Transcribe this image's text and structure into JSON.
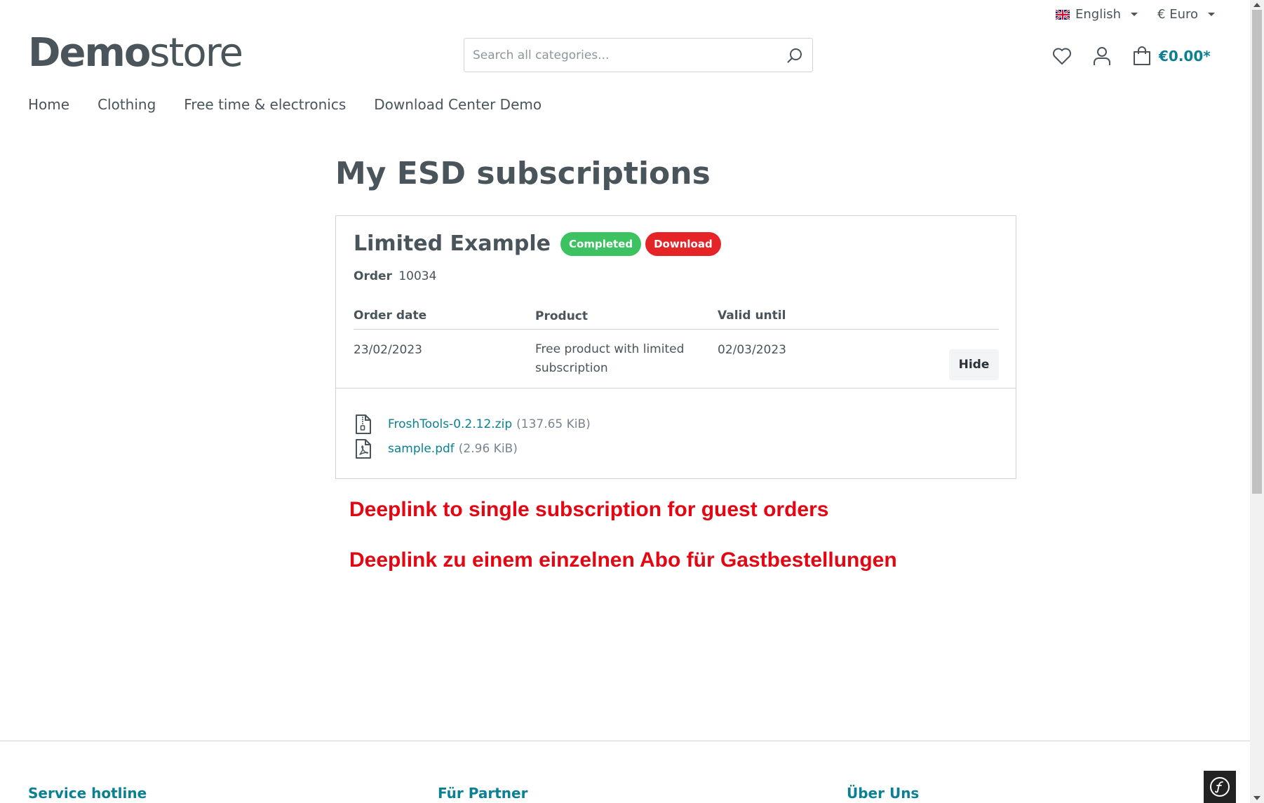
{
  "topbar": {
    "language": "English",
    "currency": "€ Euro"
  },
  "header": {
    "logo_bold": "Demo",
    "logo_light": "store",
    "search_placeholder": "Search all categories...",
    "cart_total": "€0.00*"
  },
  "nav": {
    "items": [
      {
        "label": "Home"
      },
      {
        "label": "Clothing"
      },
      {
        "label": "Free time & electronics"
      },
      {
        "label": "Download Center Demo"
      }
    ]
  },
  "main": {
    "title": "My ESD subscriptions",
    "subscription": {
      "title": "Limited Example",
      "status_badge": "Completed",
      "download_badge": "Download",
      "order_label": "Order",
      "order_number": "10034",
      "columns": [
        "Order date",
        "Product",
        "Valid until"
      ],
      "row": {
        "order_date": "23/02/2023",
        "product": "Free product with limited subscription",
        "valid_until": "02/03/2023",
        "action": "Hide"
      },
      "files": [
        {
          "name": "FroshTools-0.2.12.zip",
          "size": "(137.65 KiB)",
          "icon": "zip-file-icon"
        },
        {
          "name": "sample.pdf",
          "size": "(2.96 KiB)",
          "icon": "pdf-file-icon"
        }
      ]
    },
    "notes": [
      "Deeplink to single subscription for guest orders",
      "Deeplink zu einem einzelnen Abo für Gastbestellungen"
    ]
  },
  "footer": {
    "columns": [
      "Service hotline",
      "Für Partner",
      "Über Uns"
    ]
  },
  "colors": {
    "text": "#4a545b",
    "accent": "#0b8093",
    "success": "#3cc261",
    "danger": "#e52427",
    "annotation": "#e30613"
  }
}
